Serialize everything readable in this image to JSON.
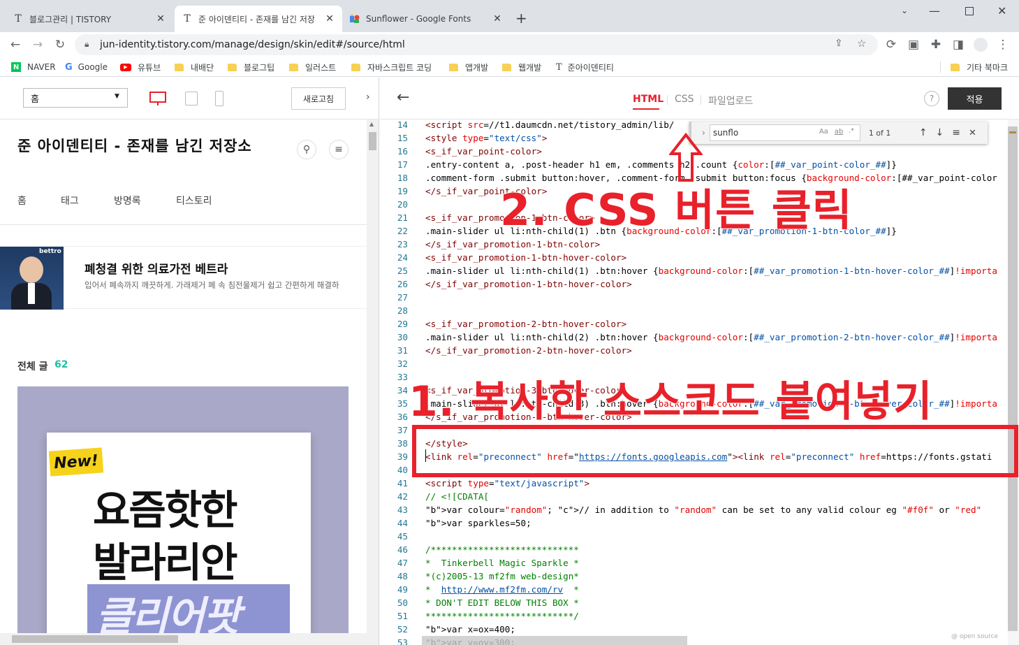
{
  "browser": {
    "tabs": [
      {
        "title": "블로그관리 | TISTORY",
        "favicon": "T"
      },
      {
        "title": "준 아이덴티티 - 존재를 남긴 저장",
        "favicon": "T"
      },
      {
        "title": "Sunflower - Google Fonts",
        "favicon": "google-fonts"
      }
    ],
    "new_tab": "+",
    "url": "jun-identity.tistory.com/manage/design/skin/edit#/source/html",
    "bookmarks": [
      {
        "label": "NAVER",
        "icon": "naver"
      },
      {
        "label": "Google",
        "icon": "google"
      },
      {
        "label": "유튜브",
        "icon": "youtube"
      },
      {
        "label": "내배단",
        "icon": "folder"
      },
      {
        "label": "블로그팁",
        "icon": "folder"
      },
      {
        "label": "일러스트",
        "icon": "folder"
      },
      {
        "label": "자바스크립트 코딩",
        "icon": "folder"
      },
      {
        "label": "앱개발",
        "icon": "folder"
      },
      {
        "label": "웹개발",
        "icon": "folder"
      },
      {
        "label": "준아이덴티티",
        "icon": "tistory"
      }
    ],
    "other_bookmarks": "기타 북마크"
  },
  "preview": {
    "page_select": "홈",
    "refresh_label": "새로고침",
    "blog_title": "준 아이덴티티 - 존재를 남긴 저장소",
    "nav": [
      "홈",
      "태그",
      "방명록",
      "티스토리"
    ],
    "ad": {
      "brand": "bettro",
      "title": "폐청결 위한 의료가전 베트라",
      "desc": "입어서 폐속까지 깨끗하게. 가래제거 폐 속 침전물제거 쉽고 간편하게 해결하"
    },
    "post_count_label": "전체 글",
    "post_count": "62",
    "thumbnail": {
      "badge": "New!",
      "line1": "요즘핫한",
      "line2": "발라리안",
      "line3": "클리어팟"
    }
  },
  "editor": {
    "tabs": [
      "HTML",
      "CSS",
      "파일업로드"
    ],
    "active_tab": "HTML",
    "help": "?",
    "apply_label": "적용",
    "find": {
      "query": "sunflo",
      "case": "Aa",
      "word": "ab",
      "regex": ".*",
      "result": "1 of 1"
    },
    "lines": [
      {
        "n": "14",
        "t": "<script src=\"//t1.daumcdn.net/tistory_admin/lib/"
      },
      {
        "n": "15",
        "t": "<style type=\"text/css\">"
      },
      {
        "n": "16",
        "t": "<s_if_var_point-color>"
      },
      {
        "n": "17",
        "t": ".entry-content a, .post-header h1 em, .comments h2 .count {color:[##_var_point-color_##]}"
      },
      {
        "n": "18",
        "t": ".comment-form .submit button:hover, .comment-form .submit button:focus {background-color:[##_var_point-color"
      },
      {
        "n": "19",
        "t": "</s_if_var_point-color>"
      },
      {
        "n": "20",
        "t": ""
      },
      {
        "n": "21",
        "t": "<s_if_var_promotion-1-btn-color>"
      },
      {
        "n": "22",
        "t": ".main-slider ul li:nth-child(1) .btn {background-color:[##_var_promotion-1-btn-color_##]}"
      },
      {
        "n": "23",
        "t": "</s_if_var_promotion-1-btn-color>"
      },
      {
        "n": "24",
        "t": "<s_if_var_promotion-1-btn-hover-color>"
      },
      {
        "n": "25",
        "t": ".main-slider ul li:nth-child(1) .btn:hover {background-color:[##_var_promotion-1-btn-hover-color_##]!importa"
      },
      {
        "n": "26",
        "t": "</s_if_var_promotion-1-btn-hover-color>"
      },
      {
        "n": "27",
        "t": ""
      },
      {
        "n": "28",
        "t": ""
      },
      {
        "n": "29",
        "t": "<s_if_var_promotion-2-btn-hover-color>"
      },
      {
        "n": "30",
        "t": ".main-slider ul li:nth-child(2) .btn:hover {background-color:[##_var_promotion-2-btn-hover-color_##]!importa"
      },
      {
        "n": "31",
        "t": "</s_if_var_promotion-2-btn-hover-color>"
      },
      {
        "n": "32",
        "t": ""
      },
      {
        "n": "33",
        "t": ""
      },
      {
        "n": "34",
        "t": "<s_if_var_promotion-3-btn-hover-color>"
      },
      {
        "n": "35",
        "t": ".main-slider ul li:nth-child(3) .btn:hover {background-color:[##_var_promotion-3-btn-hover-color_##]!importa"
      },
      {
        "n": "36",
        "t": "</s_if_var_promotion-3-btn-hover-color>"
      },
      {
        "n": "37",
        "t": ""
      },
      {
        "n": "38",
        "t": "</style>"
      },
      {
        "n": "39",
        "t": "<link rel=\"preconnect\" href=\"https://fonts.googleapis.com\"><link rel=\"preconnect\" href=\"https://fonts.gstati"
      },
      {
        "n": "40",
        "t": ""
      },
      {
        "n": "41",
        "t": "<script type=\"text/javascript\">"
      },
      {
        "n": "42",
        "t": "// <![CDATA["
      },
      {
        "n": "43",
        "t": "var colour=\"random\"; // in addition to \"random\" can be set to any valid colour eg \"#f0f\" or \"red\""
      },
      {
        "n": "44",
        "t": "var sparkles=50;"
      },
      {
        "n": "45",
        "t": ""
      },
      {
        "n": "46",
        "t": "/****************************"
      },
      {
        "n": "47",
        "t": "*  Tinkerbell Magic Sparkle *"
      },
      {
        "n": "48",
        "t": "*(c)2005-13 mf2fm web-design*"
      },
      {
        "n": "49",
        "t": "*  http://www.mf2fm.com/rv  *"
      },
      {
        "n": "50",
        "t": "* DON'T EDIT BELOW THIS BOX *"
      },
      {
        "n": "51",
        "t": "****************************/"
      },
      {
        "n": "52",
        "t": "var x=ox=400;"
      },
      {
        "n": "53",
        "t": "var y=oy=300;"
      }
    ],
    "footer_note": "@ open source"
  },
  "annotations": {
    "step1": "1. 복사한 소스코드 붙여넣기",
    "step2": "2. CSS 버튼 클릭"
  },
  "colors": {
    "accent_red": "#e8212b",
    "editor_active_tab": "#e8212b",
    "apply_bg": "#333333",
    "post_count": "#1ebfa6"
  }
}
